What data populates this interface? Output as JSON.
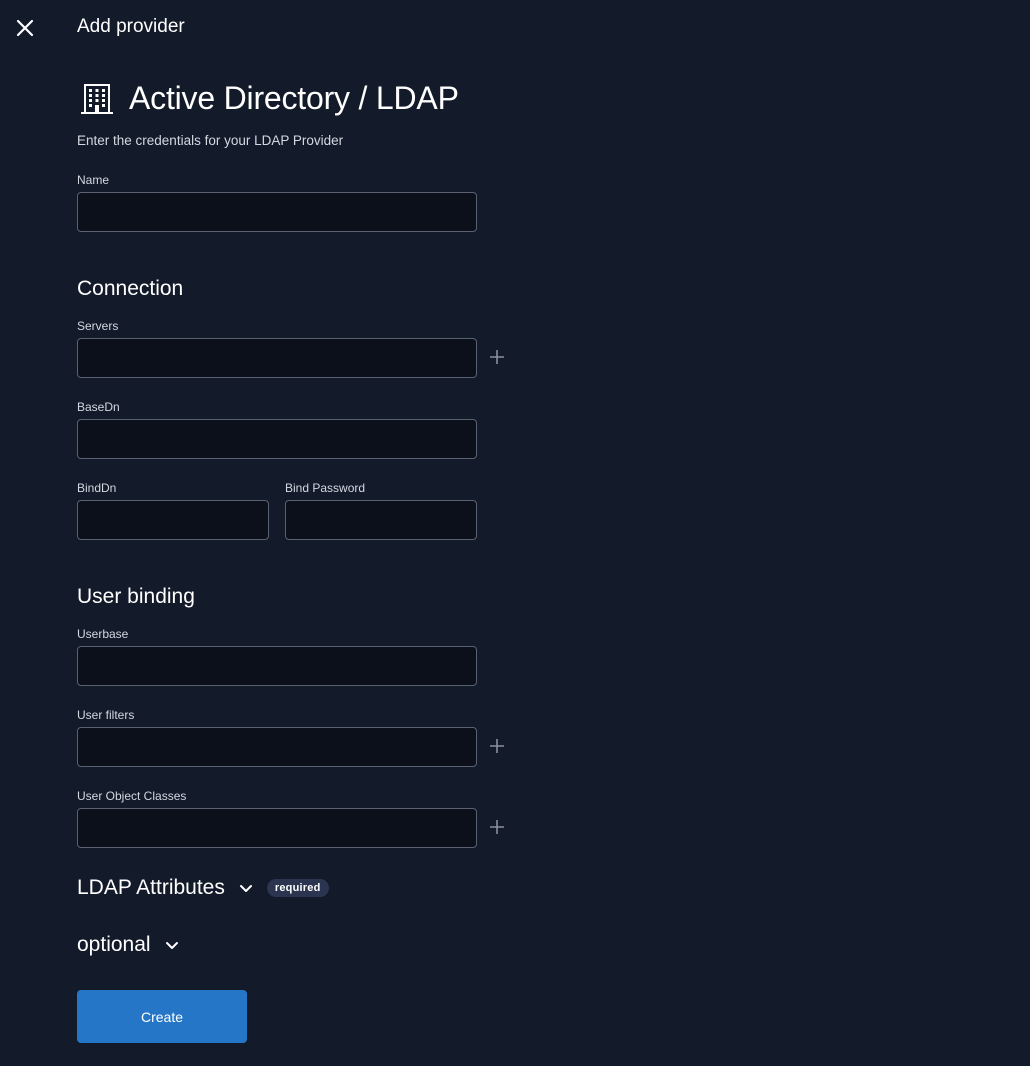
{
  "header": {
    "title": "Add provider",
    "close_icon": "close-icon"
  },
  "provider": {
    "icon": "building-icon",
    "title": "Active Directory / LDAP",
    "subtitle": "Enter the credentials for your LDAP Provider"
  },
  "fields": {
    "name": {
      "label": "Name",
      "value": ""
    },
    "servers": {
      "label": "Servers",
      "value": ""
    },
    "basedn": {
      "label": "BaseDn",
      "value": ""
    },
    "binddn": {
      "label": "BindDn",
      "value": ""
    },
    "bind_password": {
      "label": "Bind Password",
      "value": ""
    },
    "userbase": {
      "label": "Userbase",
      "value": ""
    },
    "user_filters": {
      "label": "User filters",
      "value": ""
    },
    "user_object_classes": {
      "label": "User Object Classes",
      "value": ""
    }
  },
  "sections": {
    "connection": "Connection",
    "user_binding": "User binding",
    "ldap_attributes": {
      "label": "LDAP Attributes",
      "badge": "required"
    },
    "optional": {
      "label": "optional"
    }
  },
  "actions": {
    "create_label": "Create"
  },
  "colors": {
    "background": "#131a2a",
    "input_background": "#0b101b",
    "input_border": "#5a6172",
    "primary_button": "#2676c8",
    "badge_background": "#2b3550"
  }
}
